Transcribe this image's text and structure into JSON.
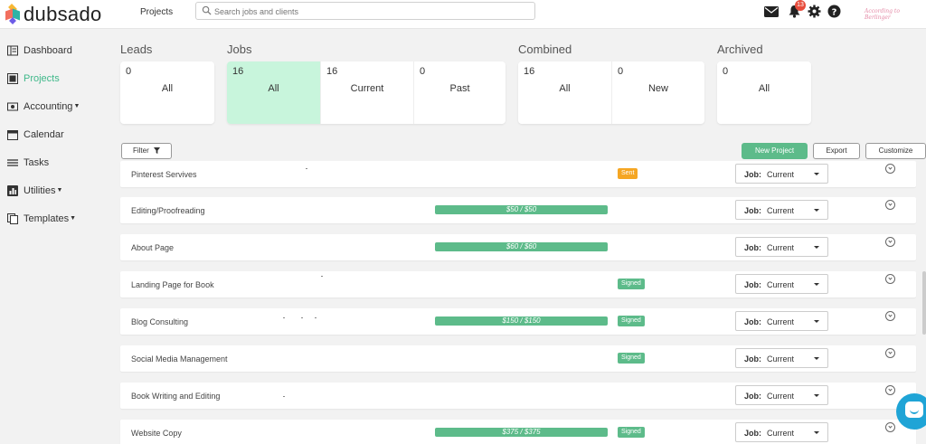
{
  "brand": {
    "name": "dubsado"
  },
  "topnav": {
    "projects_link": "Projects",
    "search_placeholder": "Search jobs and clients",
    "notif_count": "13",
    "signature": "According to Berlinger"
  },
  "sidebar": {
    "items": [
      {
        "label": "Dashboard"
      },
      {
        "label": "Projects"
      },
      {
        "label": "Accounting"
      },
      {
        "label": "Calendar"
      },
      {
        "label": "Tasks"
      },
      {
        "label": "Utilities"
      },
      {
        "label": "Templates"
      }
    ]
  },
  "stats": {
    "leads": {
      "title": "Leads",
      "all": {
        "count": "0",
        "label": "All"
      }
    },
    "jobs": {
      "title": "Jobs",
      "all": {
        "count": "16",
        "label": "All"
      },
      "current": {
        "count": "16",
        "label": "Current"
      },
      "past": {
        "count": "0",
        "label": "Past"
      }
    },
    "combined": {
      "title": "Combined",
      "all": {
        "count": "16",
        "label": "All"
      },
      "new": {
        "count": "0",
        "label": "New"
      }
    },
    "archived": {
      "title": "Archived",
      "all": {
        "count": "0",
        "label": "All"
      }
    }
  },
  "controls": {
    "filter": "Filter",
    "new_project": "New Project",
    "export": "Export",
    "customize": "Customize"
  },
  "job_select": {
    "key": "Job:",
    "value": "Current"
  },
  "rows": [
    {
      "name": "Pinterest Servives",
      "status": "Sent"
    },
    {
      "name": "Editing/Proofreading",
      "progress": "$50 / $50"
    },
    {
      "name": "About Page",
      "progress": "$60 / $60"
    },
    {
      "name": "Landing Page for Book",
      "status": "Signed"
    },
    {
      "name": "Blog Consulting",
      "progress": "$150 / $150",
      "status": "Signed"
    },
    {
      "name": "Social Media Management",
      "status": "Signed"
    },
    {
      "name": "Book Writing and Editing"
    },
    {
      "name": "Website Copy",
      "progress": "$375 / $375",
      "status": "Signed"
    }
  ]
}
